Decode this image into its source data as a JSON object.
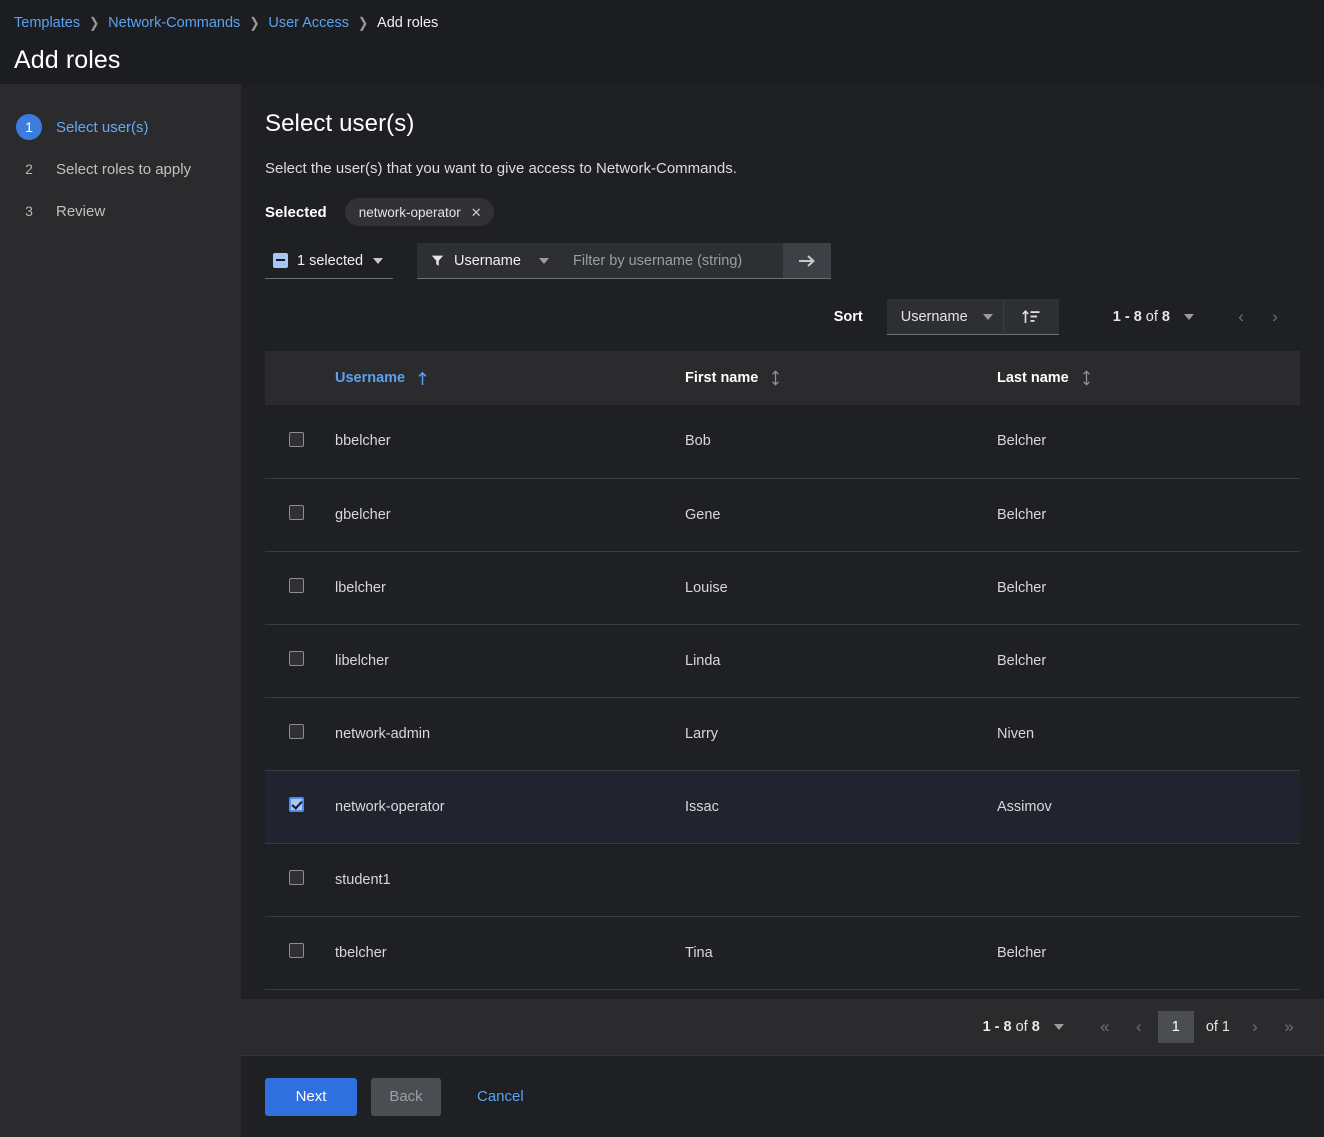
{
  "header": {
    "breadcrumb": [
      {
        "label": "Templates",
        "current": false
      },
      {
        "label": "Network-Commands",
        "current": false
      },
      {
        "label": "User Access",
        "current": false
      },
      {
        "label": "Add roles",
        "current": true
      }
    ],
    "title": "Add roles",
    "separator": "❯"
  },
  "wizard": {
    "steps": [
      {
        "num": "1",
        "label": "Select user(s)",
        "active": true
      },
      {
        "num": "2",
        "label": "Select roles to apply",
        "active": false
      },
      {
        "num": "3",
        "label": "Review",
        "active": false
      }
    ]
  },
  "main": {
    "title": "Select user(s)",
    "description": "Select the user(s) that you want to give access to Network-Commands.",
    "selected_label": "Selected",
    "selected_chips": [
      {
        "label": "network-operator",
        "remove_icon": "✕"
      }
    ]
  },
  "toolbar": {
    "bulk_select_text": "1 selected",
    "filter_attribute": "Username",
    "filter_placeholder": "Filter by username (string)",
    "filter_value": "",
    "submit_icon": "arrow-right-icon"
  },
  "sort": {
    "label": "Sort",
    "field": "Username",
    "direction_icon": "sort-ascending-icon",
    "pager_range": "1 - 8",
    "pager_of": "of",
    "pager_total": "8",
    "prev_icon": "‹",
    "next_icon": "›"
  },
  "table": {
    "columns": [
      {
        "label": "Username",
        "sorted": true,
        "sort_icon": "arrow-up-icon"
      },
      {
        "label": "First name",
        "sorted": false,
        "sort_icon": "sort-both-icon"
      },
      {
        "label": "Last name",
        "sorted": false,
        "sort_icon": "sort-both-icon"
      }
    ],
    "rows": [
      {
        "checked": false,
        "username": "bbelcher",
        "first_name": "Bob",
        "last_name": "Belcher"
      },
      {
        "checked": false,
        "username": "gbelcher",
        "first_name": "Gene",
        "last_name": "Belcher"
      },
      {
        "checked": false,
        "username": "lbelcher",
        "first_name": "Louise",
        "last_name": "Belcher"
      },
      {
        "checked": false,
        "username": "libelcher",
        "first_name": "Linda",
        "last_name": "Belcher"
      },
      {
        "checked": false,
        "username": "network-admin",
        "first_name": "Larry",
        "last_name": "Niven"
      },
      {
        "checked": true,
        "username": "network-operator",
        "first_name": "Issac",
        "last_name": "Assimov"
      },
      {
        "checked": false,
        "username": "student1",
        "first_name": "",
        "last_name": ""
      },
      {
        "checked": false,
        "username": "tbelcher",
        "first_name": "Tina",
        "last_name": "Belcher"
      }
    ]
  },
  "bottom_pager": {
    "range": "1 - 8",
    "of": "of",
    "total": "8",
    "first_icon": "«",
    "prev_icon": "‹",
    "page_value": "1",
    "page_of": "of 1",
    "next_icon": "›",
    "last_icon": "»"
  },
  "footer": {
    "next_label": "Next",
    "back_label": "Back",
    "cancel_label": "Cancel"
  }
}
